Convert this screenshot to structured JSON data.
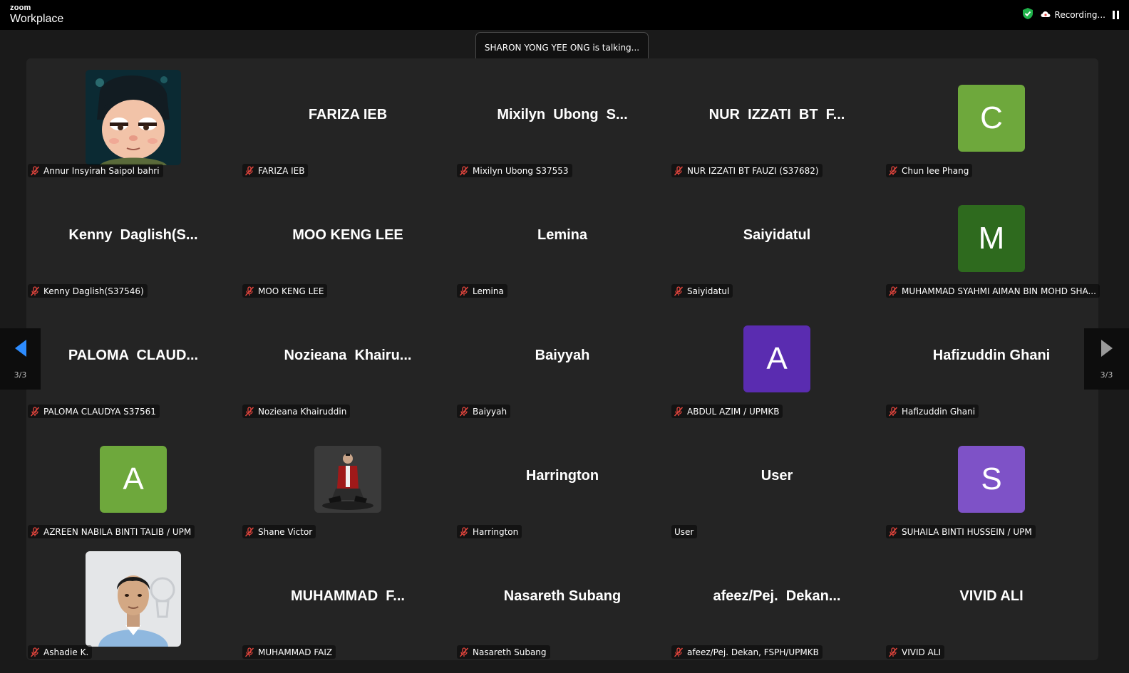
{
  "app": {
    "brand_small": "zoom",
    "brand_name": "Workplace"
  },
  "status": {
    "recording": "Recording..."
  },
  "talking_banner": "SHARON YONG YEE ONG is talking...",
  "pagination": {
    "left": "3/3",
    "right": "3/3"
  },
  "colors": {
    "green": "#6ea83c",
    "dark_green": "#2e6a1e",
    "indigo": "#5a2cb0",
    "violet": "#7e52c7",
    "mic_muted": "#e0443c"
  },
  "participants": [
    {
      "display": "",
      "name": "Annur Insyirah Saipol bahri",
      "avatar": "photo-cartoon",
      "muted": true
    },
    {
      "display": "FARIZA IEB",
      "name": "FARIZA IEB",
      "muted": true
    },
    {
      "display": "Mixilyn  Ubong  S...",
      "name": "Mixilyn Ubong S37553",
      "muted": true
    },
    {
      "display": "NUR  IZZATI  BT  F...",
      "name": "NUR IZZATI BT FAUZI (S37682)",
      "muted": true
    },
    {
      "display": "",
      "name": "Chun lee Phang",
      "avatar": "letter",
      "letter": "C",
      "color": "#6ea83c",
      "muted": true
    },
    {
      "display": "Kenny  Daglish(S...",
      "name": "Kenny Daglish(S37546)",
      "muted": true
    },
    {
      "display": "MOO KENG LEE",
      "name": "MOO KENG LEE",
      "muted": true
    },
    {
      "display": "Lemina",
      "name": "Lemina",
      "muted": true
    },
    {
      "display": "Saiyidatul",
      "name": "Saiyidatul",
      "muted": true
    },
    {
      "display": "",
      "name": "MUHAMMAD SYAHMI AIMAN BIN MOHD SHA...",
      "avatar": "letter",
      "letter": "M",
      "color": "#2e6a1e",
      "muted": true
    },
    {
      "display": "PALOMA  CLAUD...",
      "name": "PALOMA CLAUDYA S37561",
      "muted": true
    },
    {
      "display": "Nozieana  Khairu...",
      "name": "Nozieana Khairuddin",
      "muted": true
    },
    {
      "display": "Baiyyah",
      "name": "Baiyyah",
      "muted": true
    },
    {
      "display": "",
      "name": "ABDUL AZIM / UPMKB",
      "avatar": "letter",
      "letter": "A",
      "color": "#5a2cb0",
      "muted": true
    },
    {
      "display": "Hafizuddin Ghani",
      "name": "Hafizuddin Ghani",
      "muted": true
    },
    {
      "display": "",
      "name": "AZREEN NABILA BINTI TALIB / UPM",
      "avatar": "letter",
      "letter": "A",
      "color": "#6ea83c",
      "muted": true
    },
    {
      "display": "",
      "name": "Shane Victor",
      "avatar": "photo-small",
      "muted": true
    },
    {
      "display": "Harrington",
      "name": "Harrington",
      "muted": true
    },
    {
      "display": "User",
      "name": "User",
      "muted": false
    },
    {
      "display": "",
      "name": "SUHAILA BINTI HUSSEIN / UPM",
      "avatar": "letter",
      "letter": "S",
      "color": "#7e52c7",
      "muted": true
    },
    {
      "display": "",
      "name": "Ashadie K.",
      "avatar": "photo-person",
      "muted": true
    },
    {
      "display": "MUHAMMAD  F...",
      "name": "MUHAMMAD FAIZ",
      "muted": true
    },
    {
      "display": "Nasareth Subang",
      "name": "Nasareth Subang",
      "muted": true
    },
    {
      "display": "afeez/Pej.  Dekan...",
      "name": "afeez/Pej. Dekan, FSPH/UPMKB",
      "muted": true
    },
    {
      "display": "VIVID ALI",
      "name": "VIVID ALI",
      "muted": true
    }
  ]
}
